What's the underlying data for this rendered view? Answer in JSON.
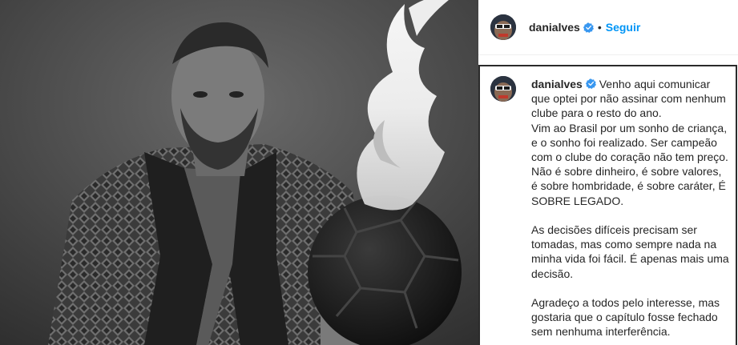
{
  "post": {
    "username": "danialves",
    "separator": "•",
    "follow_label": "Seguir"
  },
  "caption": {
    "username": "danialves",
    "lines": [
      "Venho aqui comunicar que optei por não assinar com nenhum clube para o resto do ano.",
      "Vim ao Brasil por um sonho de criança, e o sonho foi realizado. Ser campeão com o clube do coração não tem preço.",
      "Não é sobre dinheiro, é sobre valores, é sobre hombridade, é sobre caráter, É SOBRE LEGADO.",
      "",
      "As decisões difíceis precisam ser tomadas, mas como sempre nada na minha vida foi fácil. É apenas mais uma decisão.",
      "",
      "Agradeço a todos pelo interesse, mas gostaria que o capítulo fosse fechado sem nenhuma interferência."
    ]
  },
  "colors": {
    "follow": "#0095f6",
    "verified": "#3897f0",
    "text": "#262626"
  },
  "icons": {
    "verified": "verified-badge-icon"
  }
}
